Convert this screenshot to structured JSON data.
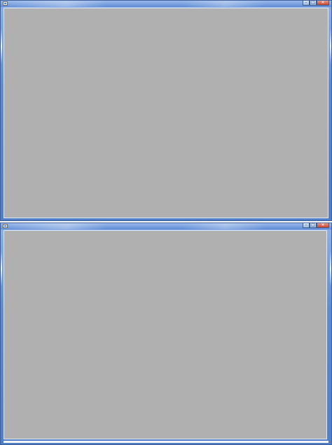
{
  "windows": [
    {
      "title": "",
      "icon": "app-window-icon",
      "caption_buttons": [
        "minimize-icon",
        "maximize-icon",
        "close-icon"
      ],
      "client_color": "#b0b0b0"
    },
    {
      "title": "",
      "icon": "app-window-icon",
      "caption_buttons": [
        "minimize-icon",
        "maximize-icon",
        "close-icon"
      ],
      "client_color": "#b0b0b0"
    }
  ],
  "colors": {
    "frame": "#5d8ad0",
    "close": "#c9402d",
    "client": "#b0b0b0"
  }
}
